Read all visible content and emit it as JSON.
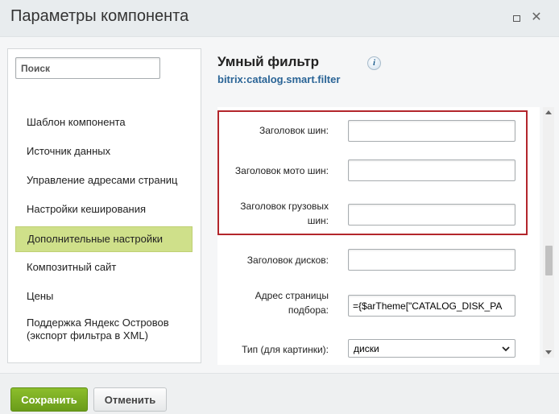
{
  "window": {
    "title": "Параметры компонента"
  },
  "sidebar": {
    "search_placeholder": "Поиск",
    "items": [
      {
        "label": "Шаблон компонента"
      },
      {
        "label": "Источник данных"
      },
      {
        "label": "Управление адресами страниц"
      },
      {
        "label": "Настройки кеширования"
      },
      {
        "label": "Дополнительные настройки",
        "active": true
      },
      {
        "label": "Композитный сайт"
      },
      {
        "label": "Цены"
      },
      {
        "label": "Поддержка Яндекс Островов (экспорт фильтра в XML)"
      }
    ]
  },
  "component": {
    "title": "Умный фильтр",
    "code": "bitrix:catalog.smart.filter",
    "info_icon": "info-icon"
  },
  "fields": [
    {
      "label": "Заголовок шин:",
      "value": ""
    },
    {
      "label": "Заголовок мото шин:",
      "value": ""
    },
    {
      "label": "Заголовок грузовых шин:",
      "value": ""
    },
    {
      "label": "Заголовок дисков:",
      "value": ""
    },
    {
      "label": "Адрес страницы подбора:",
      "value": "={$arTheme[\"CATALOG_DISK_PA"
    },
    {
      "label": "Тип (для картинки):",
      "value": "диски"
    }
  ],
  "footer": {
    "save_label": "Сохранить",
    "cancel_label": "Отменить"
  },
  "colors": {
    "accent_green": "#cfe08a",
    "highlight_red": "#b3262c",
    "link_blue": "#2a6496",
    "save_green": "#7aad22"
  }
}
